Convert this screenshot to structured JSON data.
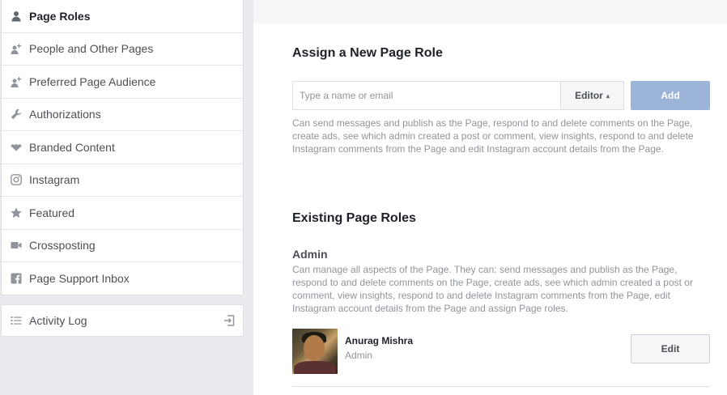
{
  "sidebar": {
    "items": [
      {
        "label": "Page Roles",
        "icon": "person-icon",
        "active": true
      },
      {
        "label": "People and Other Pages",
        "icon": "people-add-icon",
        "active": false
      },
      {
        "label": "Preferred Page Audience",
        "icon": "people-add-icon",
        "active": false
      },
      {
        "label": "Authorizations",
        "icon": "wrench-icon",
        "active": false
      },
      {
        "label": "Branded Content",
        "icon": "handshake-icon",
        "active": false
      },
      {
        "label": "Instagram",
        "icon": "instagram-icon",
        "active": false
      },
      {
        "label": "Featured",
        "icon": "star-icon",
        "active": false
      },
      {
        "label": "Crossposting",
        "icon": "video-camera-icon",
        "active": false
      },
      {
        "label": "Page Support Inbox",
        "icon": "facebook-icon",
        "active": false
      }
    ],
    "activity_log": {
      "label": "Activity Log",
      "icon": "list-icon",
      "exit_icon": "exit-icon"
    }
  },
  "assign": {
    "title": "Assign a New Page Role",
    "placeholder": "Type a name or email",
    "role_value": "Editor",
    "add_label": "Add",
    "description": "Can send messages and publish as the Page, respond to and delete comments on the Page, create ads, see which admin created a post or comment, view insights, respond to and delete Instagram comments from the Page and edit Instagram account details from the Page."
  },
  "existing": {
    "title": "Existing Page Roles",
    "role_heading": "Admin",
    "role_description": "Can manage all aspects of the Page. They can: send messages and publish as the Page, respond to and delete comments on the Page, create ads, see which admin created a post or comment, view insights, respond to and delete Instagram comments from the Page, edit Instagram account details from the Page and assign Page roles.",
    "user": {
      "name": "Anurag Mishra",
      "role": "Admin"
    },
    "edit_label": "Edit"
  },
  "colors": {
    "add_button": "#9cb4d8",
    "background": "#e9ebee",
    "muted_text": "#90949c"
  }
}
